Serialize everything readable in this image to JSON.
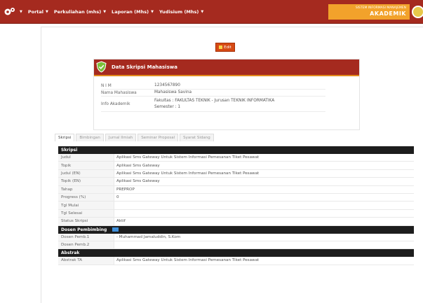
{
  "nav": {
    "items": [
      {
        "label": "Portal"
      },
      {
        "label": "Perkuliahan (mhs)"
      },
      {
        "label": "Laporan (Mhs)"
      },
      {
        "label": "Yudisium (Mhs)"
      }
    ],
    "brand_line1": "SISTEM INFORMASI MANAJEMEN",
    "brand_line2": "AKADEMIK"
  },
  "edit_label": "Edit",
  "card": {
    "title": "Data Skripsi Mahasiswa",
    "rows": [
      {
        "key": "N I M",
        "value": "1234567890"
      },
      {
        "key": "Nama Mahasiswa",
        "value": "Mahasiswa Savina"
      },
      {
        "key": "Info Akademik",
        "value": "Fakultas   : FAKULTAS TEKNIK - Jurusan TEKNIK INFORMATIKA",
        "value2": "Semester : 1"
      }
    ]
  },
  "tabs": [
    "Skripsi",
    "Bimbingan",
    "Jurnal Ilmiah",
    "Seminar Proposal",
    "Syarat Sidang"
  ],
  "skripsi": {
    "header": "Skripsi",
    "rows": [
      {
        "key": "Judul",
        "value": "Aplikasi Sms Gateway Untuk Sistem Informasi Pemesanan Tiket Pesawat"
      },
      {
        "key": "Topik",
        "value": "Aplikasi Sms Gateway"
      },
      {
        "key": "Judul (EN)",
        "value": "Aplikasi Sms Gateway Untuk Sistem Informasi Pemesanan Tiket Pesawat"
      },
      {
        "key": "Topik (EN)",
        "value": "Aplikasi Sms Gateway"
      },
      {
        "key": "Tahap",
        "value": "PREPROP"
      },
      {
        "key": "Progress (%)",
        "value": "0"
      },
      {
        "key": "Tgl Mulai",
        "value": ""
      },
      {
        "key": "Tgl Selesai",
        "value": ""
      },
      {
        "key": "Status Skripsi",
        "value": "Aktif"
      }
    ]
  },
  "dosen": {
    "header": "Dosen Pembimbing",
    "rows": [
      {
        "key": "Dosen Pemb.1",
        "value": "- Muhammad Jamaluddin, S.Kom"
      },
      {
        "key": "Dosen Pemb.2",
        "value": ""
      }
    ]
  },
  "abstrak": {
    "header": "Abstrak",
    "rows": [
      {
        "key": "Abstrak TA",
        "value": "Aplikasi Sms Gateway Untuk Sistem Informasi Pemesanan Tiket Pesawat"
      }
    ]
  },
  "colors": {
    "nav_bg": "#a52a1f",
    "brand_bg": "#f2a22b",
    "edit_bg": "#d64a14",
    "section_bg": "#1d1d1d"
  }
}
